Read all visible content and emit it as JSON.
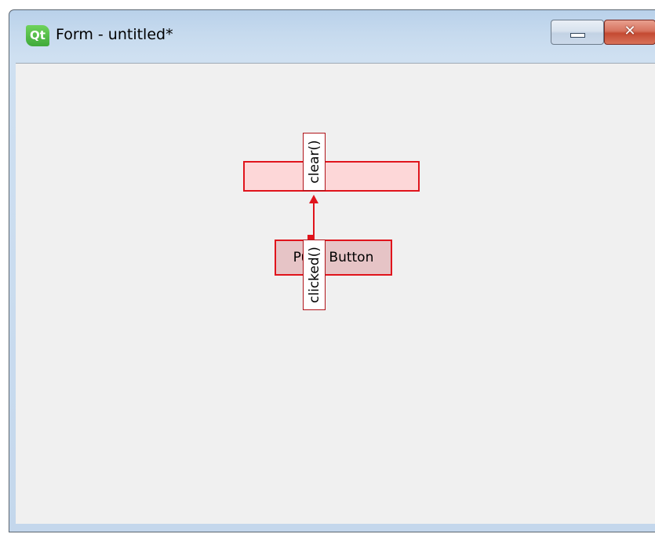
{
  "window": {
    "logo_text": "Qt",
    "title": "Form - untitled*",
    "minimize_label": "",
    "close_label": "✕"
  },
  "form": {
    "push_button_label": "Push Button",
    "receiver_slot": "clear()",
    "sender_signal": "clicked()"
  },
  "colors": {
    "selection_red": "#e0141c",
    "client_background": "#f0f0f0"
  }
}
